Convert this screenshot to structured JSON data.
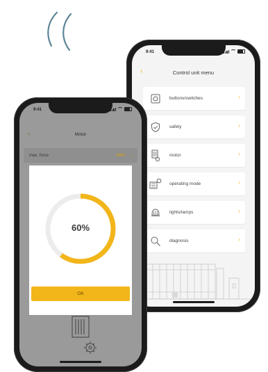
{
  "right_phone": {
    "status_time": "9:41",
    "title": "Control unit menu",
    "menu_items": [
      {
        "label": "buttons/switches",
        "icon": "button-switch-icon"
      },
      {
        "label": "safety",
        "icon": "shield-icon"
      },
      {
        "label": "motor",
        "icon": "motor-icon"
      },
      {
        "label": "operating mode",
        "icon": "operating-mode-icon"
      },
      {
        "label": "lights/lamps",
        "icon": "lamp-icon"
      },
      {
        "label": "diagnosis",
        "icon": "magnifier-icon"
      }
    ]
  },
  "left_phone": {
    "status_time": "9:41",
    "title": "Motor",
    "param": {
      "label": "max. force",
      "value": "60%"
    },
    "dialog": {
      "progress": 60,
      "progress_label": "60%",
      "ok_label": "OK"
    }
  },
  "colors": {
    "accent": "#f2b51a",
    "track": "#ececec"
  }
}
